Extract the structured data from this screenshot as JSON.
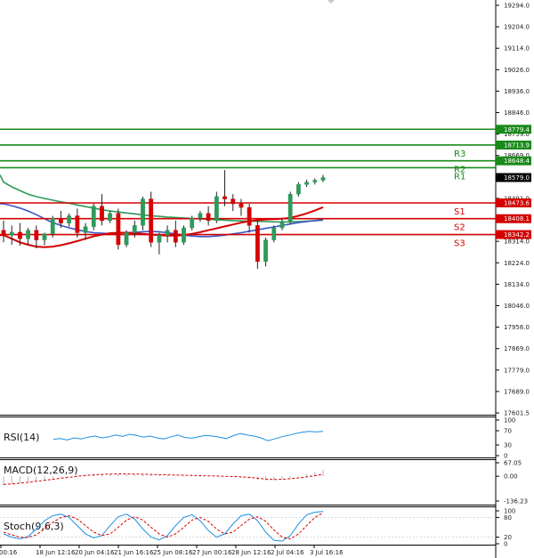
{
  "chart_data": {
    "type": "candlestick",
    "price_axis": {
      "ticks": [
        "19294.0",
        "19204.0",
        "19114.0",
        "19026.0",
        "18936.0",
        "18846.0",
        "18759.0",
        "18669.0",
        "18579.0",
        "18491.0",
        "18401.0",
        "18314.0",
        "18224.0",
        "18134.0",
        "18046.0",
        "17956.0",
        "17869.0",
        "17779.0",
        "17689.0",
        "17601.5"
      ],
      "range": [
        17601.5,
        19294.0
      ]
    },
    "time_axis": {
      "labels": [
        "00:16",
        "18 Jun 12:16",
        "20 Jun 04:16",
        "21 Jun 16:16",
        "25 Jun 08:16",
        "27 Jun 00:16",
        "28 Jun 12:16",
        "2 Jul 04:16",
        "3 Jul 16:16"
      ]
    },
    "last_price": {
      "label": "18579.0",
      "value": 18579.0,
      "color": "#000000"
    },
    "levels": [
      {
        "name": "",
        "label": "18779.4",
        "value": 18779.4,
        "color": "#1a8a1a"
      },
      {
        "name": "R3",
        "label": "18713.9",
        "value": 18713.9,
        "color": "#1a8a1a"
      },
      {
        "name": "R2",
        "label": "18648.4",
        "value": 18648.4,
        "color": "#1a8a1a"
      },
      {
        "name": "R1",
        "label": "",
        "value": 18620.0,
        "color": "#1a8a1a"
      },
      {
        "name": "S1",
        "label": "18473.6",
        "value": 18473.6,
        "color": "#d40000"
      },
      {
        "name": "S2",
        "label": "18408.1",
        "value": 18408.1,
        "color": "#d40000"
      },
      {
        "name": "S3",
        "label": "18342.2",
        "value": 18342.2,
        "color": "#d40000"
      }
    ],
    "moving_averages": [
      {
        "color": "#2e9a5a",
        "values": [
          18560,
          18540,
          18525,
          18510,
          18500,
          18492,
          18485,
          18478,
          18472,
          18465,
          18458,
          18452,
          18445,
          18440,
          18436,
          18432,
          18428,
          18424,
          18420,
          18418,
          18415,
          18413,
          18411,
          18409,
          18407,
          18406,
          18404,
          18402,
          18400,
          18399,
          18398,
          18397,
          18396,
          18395,
          18395,
          18395,
          18396,
          18398,
          18400,
          18402
        ]
      },
      {
        "color": "#3a55c8",
        "values": [
          18470,
          18462,
          18452,
          18440,
          18425,
          18408,
          18392,
          18380,
          18370,
          18362,
          18355,
          18350,
          18348,
          18346,
          18348,
          18350,
          18352,
          18354,
          18355,
          18354,
          18350,
          18345,
          18340,
          18336,
          18334,
          18334,
          18336,
          18340,
          18345,
          18350,
          18356,
          18362,
          18368,
          18374,
          18380,
          18386,
          18392,
          18396,
          18400,
          18404
        ]
      },
      {
        "color": "#d40000",
        "values": [
          18340,
          18325,
          18310,
          18300,
          18292,
          18290,
          18292,
          18298,
          18306,
          18315,
          18325,
          18335,
          18342,
          18348,
          18350,
          18350,
          18348,
          18345,
          18342,
          18340,
          18338,
          18338,
          18340,
          18345,
          18352,
          18360,
          18368,
          18376,
          18384,
          18392,
          18398,
          18402,
          18405,
          18406,
          18408,
          18412,
          18420,
          18430,
          18442,
          18456
        ]
      }
    ],
    "candles": [
      {
        "o": 18360,
        "h": 18400,
        "c": 18340,
        "l": 18310
      },
      {
        "o": 18340,
        "h": 18380,
        "c": 18352,
        "l": 18300
      },
      {
        "o": 18352,
        "h": 18390,
        "c": 18325,
        "l": 18296
      },
      {
        "o": 18325,
        "h": 18370,
        "c": 18360,
        "l": 18300
      },
      {
        "o": 18360,
        "h": 18380,
        "c": 18320,
        "l": 18285
      },
      {
        "o": 18320,
        "h": 18350,
        "c": 18345,
        "l": 18298
      },
      {
        "o": 18345,
        "h": 18420,
        "c": 18410,
        "l": 18330
      },
      {
        "o": 18410,
        "h": 18440,
        "c": 18390,
        "l": 18370
      },
      {
        "o": 18390,
        "h": 18430,
        "c": 18420,
        "l": 18375
      },
      {
        "o": 18420,
        "h": 18450,
        "c": 18350,
        "l": 18330
      },
      {
        "o": 18350,
        "h": 18390,
        "c": 18375,
        "l": 18320
      },
      {
        "o": 18375,
        "h": 18470,
        "c": 18460,
        "l": 18360
      },
      {
        "o": 18460,
        "h": 18510,
        "c": 18400,
        "l": 18380
      },
      {
        "o": 18400,
        "h": 18440,
        "c": 18430,
        "l": 18390
      },
      {
        "o": 18430,
        "h": 18450,
        "c": 18300,
        "l": 18280
      },
      {
        "o": 18300,
        "h": 18360,
        "c": 18350,
        "l": 18290
      },
      {
        "o": 18350,
        "h": 18400,
        "c": 18380,
        "l": 18330
      },
      {
        "o": 18380,
        "h": 18500,
        "c": 18490,
        "l": 18360
      },
      {
        "o": 18490,
        "h": 18520,
        "c": 18310,
        "l": 18290
      },
      {
        "o": 18310,
        "h": 18350,
        "c": 18340,
        "l": 18260
      },
      {
        "o": 18340,
        "h": 18380,
        "c": 18360,
        "l": 18310
      },
      {
        "o": 18360,
        "h": 18400,
        "c": 18310,
        "l": 18290
      },
      {
        "o": 18310,
        "h": 18380,
        "c": 18370,
        "l": 18300
      },
      {
        "o": 18370,
        "h": 18420,
        "c": 18410,
        "l": 18360
      },
      {
        "o": 18410,
        "h": 18440,
        "c": 18430,
        "l": 18395
      },
      {
        "o": 18430,
        "h": 18460,
        "c": 18400,
        "l": 18380
      },
      {
        "o": 18400,
        "h": 18520,
        "c": 18500,
        "l": 18390
      },
      {
        "o": 18500,
        "h": 18610,
        "c": 18490,
        "l": 18460
      },
      {
        "o": 18490,
        "h": 18510,
        "c": 18470,
        "l": 18440
      },
      {
        "o": 18470,
        "h": 18490,
        "c": 18455,
        "l": 18420
      },
      {
        "o": 18455,
        "h": 18470,
        "c": 18380,
        "l": 18350
      },
      {
        "o": 18380,
        "h": 18400,
        "c": 18230,
        "l": 18200
      },
      {
        "o": 18230,
        "h": 18330,
        "c": 18320,
        "l": 18210
      },
      {
        "o": 18320,
        "h": 18380,
        "c": 18370,
        "l": 18310
      },
      {
        "o": 18370,
        "h": 18410,
        "c": 18395,
        "l": 18360
      },
      {
        "o": 18395,
        "h": 18520,
        "c": 18510,
        "l": 18385
      },
      {
        "o": 18510,
        "h": 18560,
        "c": 18550,
        "l": 18500
      },
      {
        "o": 18550,
        "h": 18570,
        "c": 18560,
        "l": 18540
      },
      {
        "o": 18560,
        "h": 18575,
        "c": 18568,
        "l": 18550
      },
      {
        "o": 18568,
        "h": 18590,
        "c": 18579,
        "l": 18560
      }
    ],
    "candle_colors": {
      "up": "#2e9a5a",
      "down": "#d40000"
    }
  },
  "rsi": {
    "name": "RSI(14)",
    "ticks": [
      "100",
      "70",
      "30",
      "0"
    ],
    "color": "#1f8fe0",
    "values": [
      46,
      48,
      44,
      50,
      47,
      52,
      55,
      50,
      53,
      58,
      54,
      60,
      57,
      52,
      55,
      50,
      47,
      53,
      58,
      51,
      49,
      53,
      57,
      55,
      52,
      48,
      56,
      62,
      58,
      55,
      50,
      42,
      47,
      53,
      57,
      62,
      66,
      68,
      67,
      68
    ]
  },
  "macd": {
    "name": "MACD(12,26,9)",
    "ticks": [
      "67.05",
      "0.00",
      "-136.23"
    ],
    "bar_color": "#b5b5b5",
    "signal_color": "#d40000",
    "histogram": [
      -45,
      -40,
      -35,
      -30,
      -25,
      -18,
      -12,
      -6,
      0,
      5,
      8,
      10,
      12,
      13,
      12,
      10,
      8,
      7,
      6,
      6,
      5,
      4,
      3,
      2,
      2,
      1,
      0,
      -2,
      -4,
      -6,
      -10,
      -18,
      -22,
      -20,
      -15,
      -8,
      2,
      12,
      22,
      32
    ],
    "signal": [
      -40,
      -38,
      -34,
      -30,
      -25,
      -20,
      -15,
      -10,
      -5,
      0,
      4,
      7,
      9,
      11,
      12,
      12,
      11,
      10,
      9,
      8,
      7,
      6,
      5,
      4,
      3,
      2,
      1,
      0,
      -1,
      -3,
      -6,
      -10,
      -14,
      -16,
      -15,
      -12,
      -8,
      -3,
      3,
      10
    ]
  },
  "stoch": {
    "name": "Stoch(9,6,3)",
    "ticks": [
      "100",
      "80",
      "20",
      "0"
    ],
    "main_color": "#1f8fe0",
    "signal_color": "#d40000",
    "main": [
      30,
      20,
      15,
      22,
      45,
      70,
      85,
      90,
      80,
      55,
      30,
      18,
      25,
      55,
      82,
      90,
      75,
      45,
      20,
      12,
      25,
      55,
      80,
      88,
      70,
      40,
      20,
      30,
      60,
      85,
      90,
      70,
      35,
      10,
      8,
      25,
      60,
      88,
      96,
      98
    ],
    "signal": [
      35,
      27,
      20,
      19,
      27,
      45,
      65,
      80,
      85,
      75,
      55,
      35,
      25,
      30,
      50,
      72,
      82,
      72,
      50,
      30,
      20,
      30,
      50,
      72,
      80,
      68,
      45,
      30,
      35,
      55,
      75,
      82,
      68,
      42,
      20,
      15,
      30,
      55,
      80,
      94
    ]
  }
}
